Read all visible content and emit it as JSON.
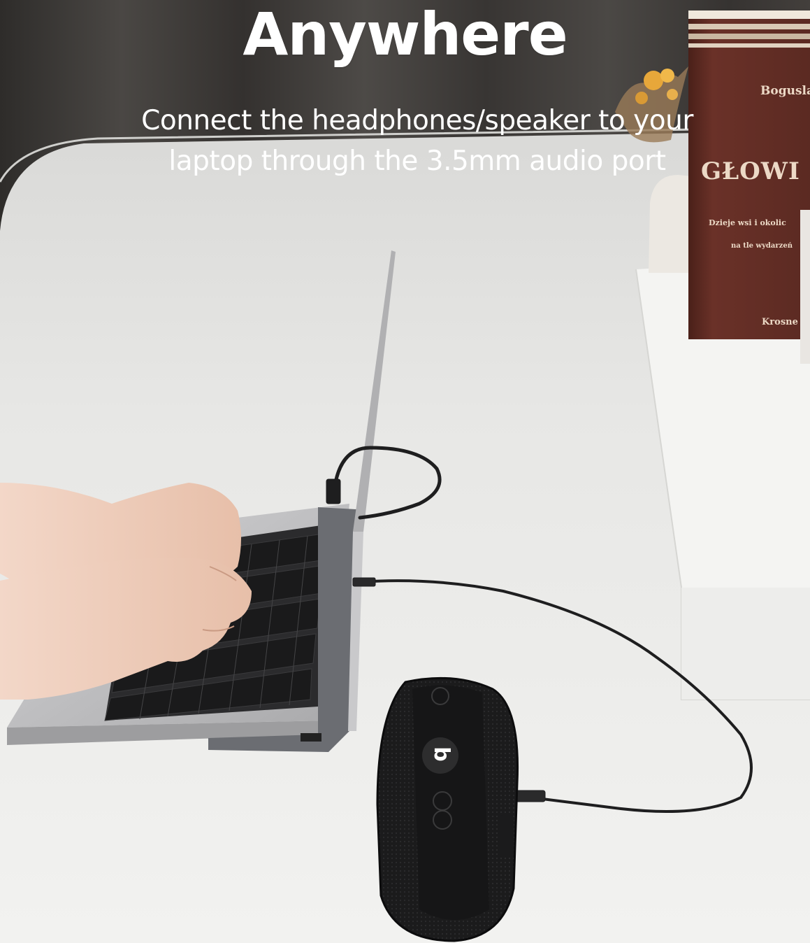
{
  "headline": "Anywhere",
  "subheadline": {
    "line1": "Connect the headphones/speaker to your",
    "line2": "laptop through the 3.5mm audio port"
  },
  "book": {
    "author": "Bogusla",
    "title": "GŁOWI",
    "line1": "Dzieje wsi i okolic",
    "line2": "na tle wydarzeń",
    "publisher": "Krosne"
  },
  "speaker_logo": "b",
  "colors": {
    "curtain": "#3f3c39",
    "desk": "#e6e6e4",
    "book": "#5a2a22",
    "speaker": "#1a1a1a",
    "laptop": "#b9b9bb"
  }
}
